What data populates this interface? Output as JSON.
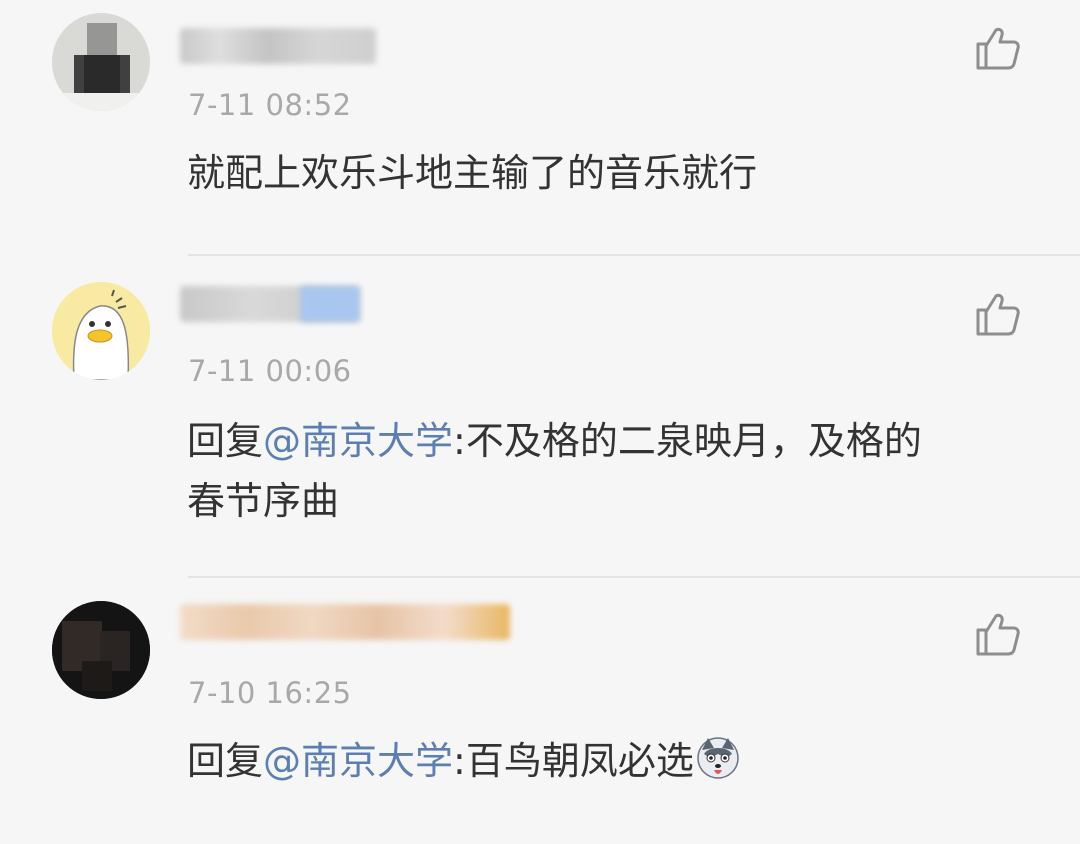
{
  "comments": [
    {
      "timestamp": "7-11 08:52",
      "text": "就配上欢乐斗地主输了的音乐就行",
      "like_icon": "thumbs-up-icon"
    },
    {
      "timestamp": "7-11 00:06",
      "reply_prefix": "回复",
      "mention": "@南京大学",
      "text_line1": ":不及格的二泉映月，及格的",
      "text_line2": "春节序曲",
      "like_icon": "thumbs-up-icon"
    },
    {
      "timestamp": "7-10 16:25",
      "reply_prefix": "回复",
      "mention": "@南京大学",
      "text": ":百鸟朝凤必选",
      "emoji": "husky-dog-emoji",
      "like_icon": "thumbs-up-icon"
    }
  ],
  "colors": {
    "background": "#f6f6f6",
    "mention": "#5d7fb0",
    "timestamp": "#a8a8a8",
    "text": "#333333"
  }
}
